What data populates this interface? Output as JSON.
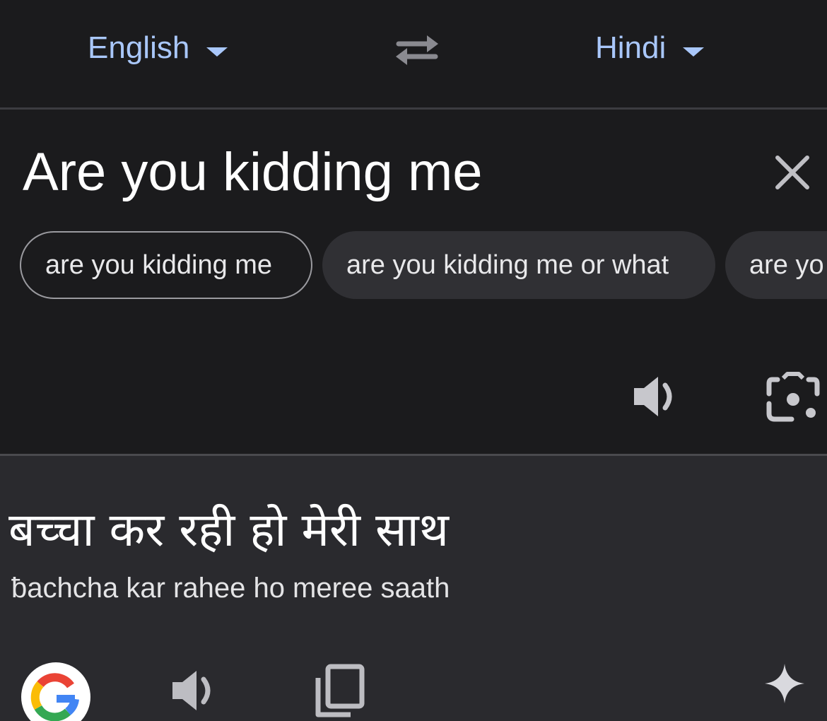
{
  "language_bar": {
    "source_language": "English",
    "target_language": "Hindi",
    "swap_icon": "swap-arrows-icon",
    "caret_icon": "caret-down-icon",
    "accent_color": "#a9c7fa"
  },
  "source": {
    "text": "Are you kidding me",
    "clear_icon": "close-icon",
    "suggestions": [
      "are you kidding me",
      "are you kidding me or what",
      "are yo"
    ],
    "speaker_icon": "speaker-icon",
    "lens_icon": "camera-lens-icon"
  },
  "translation": {
    "text": "बच्चा कर रही हो मेरी साथ",
    "transliteration": "ƀachcha kar rahee ho meree saath",
    "google_icon": "google-g-icon",
    "speaker_icon": "speaker-icon",
    "copy_icon": "copy-icon",
    "sparkle_icon": "sparkle-icon"
  }
}
